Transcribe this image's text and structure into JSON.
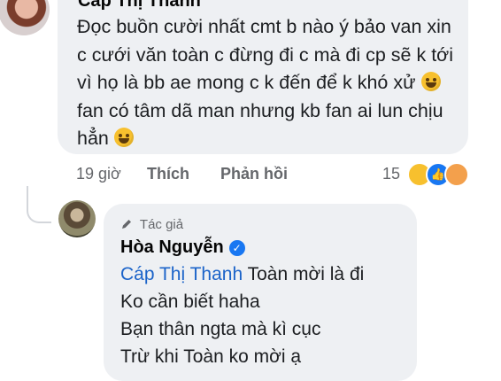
{
  "comment": {
    "author": "Cáp Thị Thanh",
    "text_part1": "Đọc buồn cười nhất cmt b nào ý bảo van xin c cưới văn toàn c đừng đi c mà đi cp sẽ k tới vì họ là bb ae mong c k đến để k khó xử",
    "text_part2": "fan có tâm dã man nhưng kb fan ai lun chịu hẳn",
    "time": "19 giờ",
    "like_label": "Thích",
    "reply_label": "Phản hồi",
    "reaction_count": "15",
    "reactions": [
      "haha-reaction",
      "like-reaction",
      "care-reaction"
    ]
  },
  "reply": {
    "badge": "Tác giả",
    "author": "Hòa Nguyễn",
    "mention": "Cáp Thị Thanh",
    "line1_rest": "Toàn mời là đi",
    "line2": "Ko cần biết haha",
    "line3": "Bạn thân ngta mà kì cục",
    "line4": "Trừ khi Toàn ko mời ạ"
  },
  "colors": {
    "bubble": "#eef0f3",
    "mention": "#1b63c9",
    "meta": "#65676b",
    "verified": "#1877f2"
  }
}
